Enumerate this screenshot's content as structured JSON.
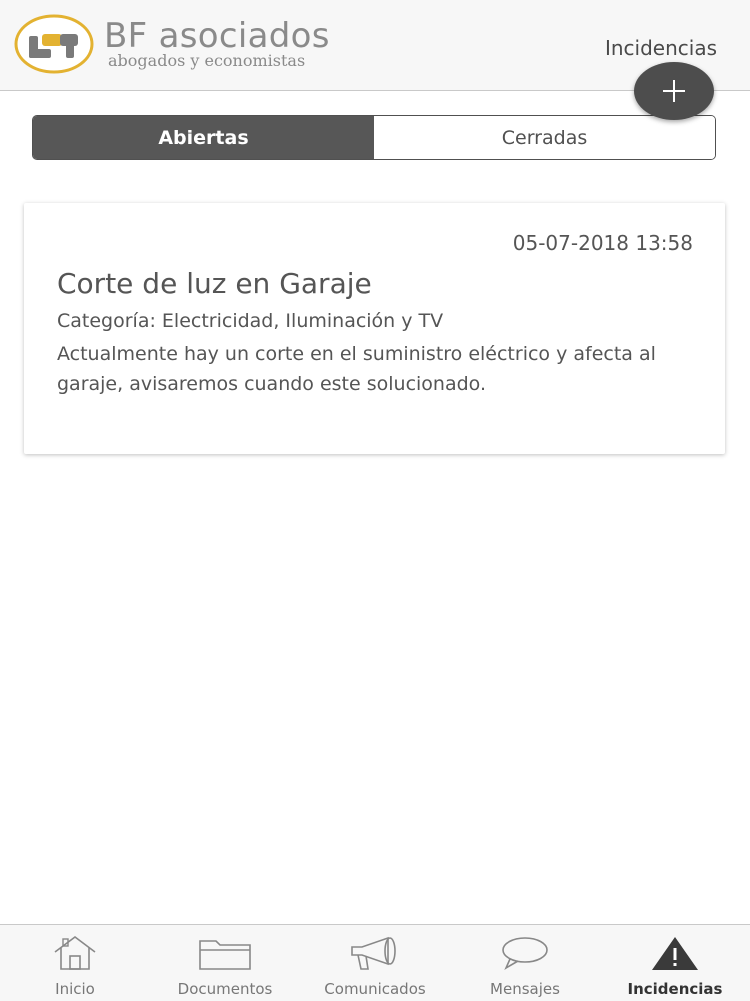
{
  "header": {
    "brand_name": "BF asociados",
    "brand_tagline": "abogados y economistas",
    "title": "Incidencias",
    "add_icon": "plus-icon",
    "logo_accent_color": "#e3b231"
  },
  "segments": {
    "open_label": "Abiertas",
    "closed_label": "Cerradas",
    "selected": "Abiertas"
  },
  "incidents": [
    {
      "date": "05-07-2018 13:58",
      "title": "Corte de luz en Garaje",
      "category": "Categoría: Electricidad, Iluminación y TV",
      "description": "Actualmente hay un corte en el suministro eléctrico y afecta al garaje, avisaremos cuando este solucionado."
    }
  ],
  "tabbar": {
    "items": [
      {
        "label": "Inicio",
        "icon": "home-icon"
      },
      {
        "label": "Documentos",
        "icon": "folder-icon"
      },
      {
        "label": "Comunicados",
        "icon": "megaphone-icon"
      },
      {
        "label": "Mensajes",
        "icon": "chat-bubble-icon"
      },
      {
        "label": "Incidencias",
        "icon": "warning-icon"
      }
    ],
    "active": "Incidencias"
  },
  "colors": {
    "header_bg": "#f7f7f7",
    "active_segment": "#575757",
    "fab": "#4d4d4d",
    "text": "#555555"
  }
}
